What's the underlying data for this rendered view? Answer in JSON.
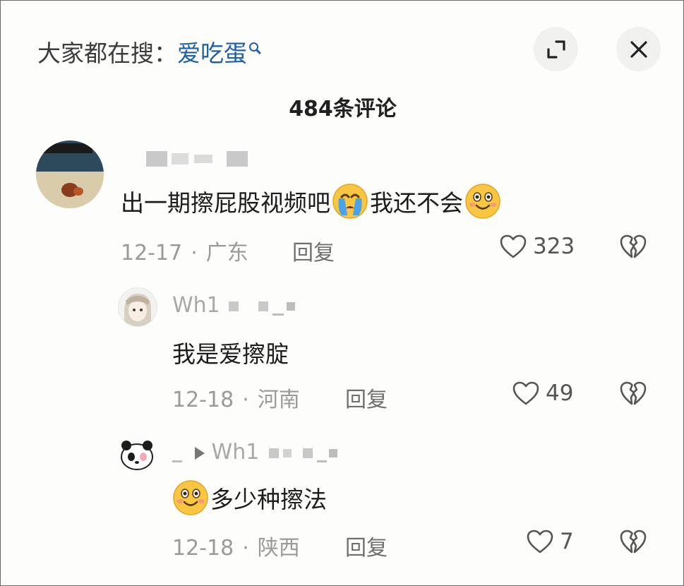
{
  "header": {
    "hot_search_label": "大家都在搜：",
    "hot_search_keyword": "爱吃蛋"
  },
  "title": "484条评论",
  "comments": [
    {
      "username": "",
      "text_before": "出一期擦屁股视频吧",
      "text_after": "我还不会",
      "date": "12-17",
      "location": "广东",
      "reply_label": "回复",
      "likes": "323"
    },
    {
      "username": "Wh1",
      "text": "我是爱擦腚",
      "date": "12-18",
      "location": "河南",
      "reply_label": "回复",
      "likes": "49"
    },
    {
      "username": "Wh1",
      "text": "多少种擦法",
      "date": "12-18",
      "location": "陕西",
      "reply_label": "回复",
      "likes": "7"
    }
  ],
  "icons": {
    "expand": "expand-icon",
    "close": "close-icon",
    "like": "heart-outline-icon",
    "dislike": "broken-heart-icon",
    "emoji_cry": "crying-face-emoji",
    "emoji_smile": "smiling-face-emoji"
  },
  "colors": {
    "keyword": "#1e5fa8",
    "title": "#202020",
    "meta": "#9a9a9a"
  }
}
